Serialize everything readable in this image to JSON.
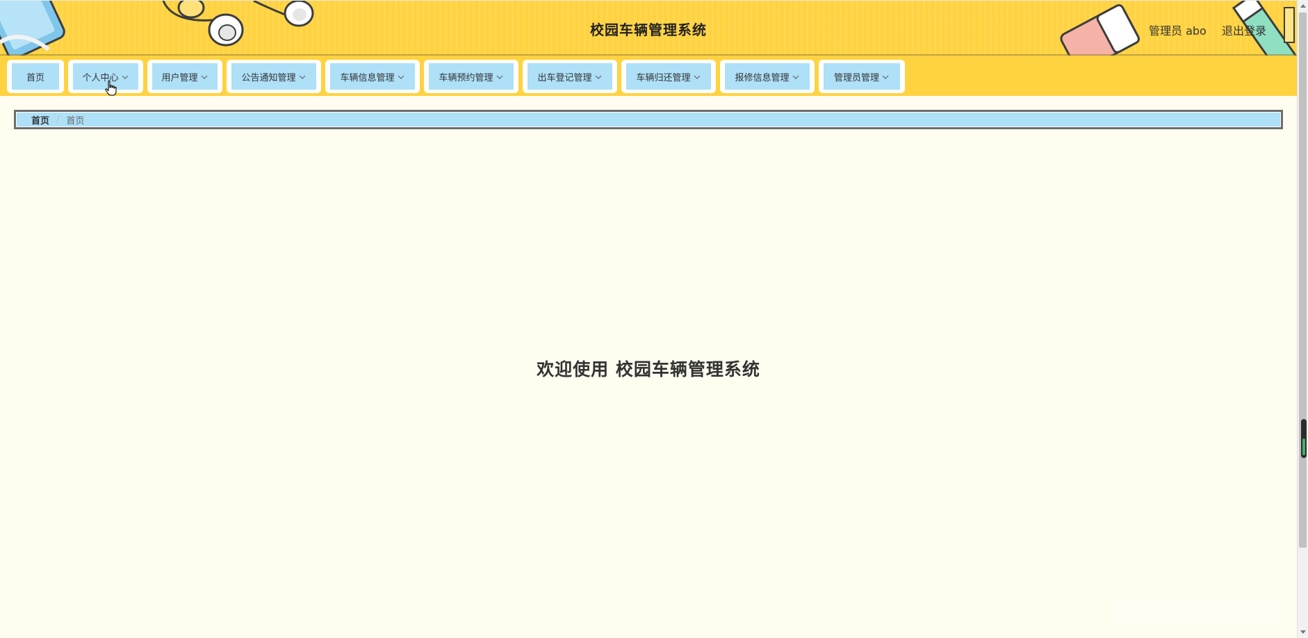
{
  "header": {
    "title": "校园车辆管理系统",
    "admin_label": "管理员 abo",
    "logout_label": "退出登录"
  },
  "nav": {
    "items": [
      {
        "label": "首页",
        "has_dropdown": false
      },
      {
        "label": "个人中心",
        "has_dropdown": true
      },
      {
        "label": "用户管理",
        "has_dropdown": true
      },
      {
        "label": "公告通知管理",
        "has_dropdown": true
      },
      {
        "label": "车辆信息管理",
        "has_dropdown": true
      },
      {
        "label": "车辆预约管理",
        "has_dropdown": true
      },
      {
        "label": "出车登记管理",
        "has_dropdown": true
      },
      {
        "label": "车辆归还管理",
        "has_dropdown": true
      },
      {
        "label": "报修信息管理",
        "has_dropdown": true
      },
      {
        "label": "管理员管理",
        "has_dropdown": true
      }
    ]
  },
  "breadcrumb": {
    "home": "首页",
    "separator": "/",
    "current": "首页"
  },
  "main": {
    "welcome": "欢迎使用 校园车辆管理系统"
  },
  "colors": {
    "header_bg": "#ffd23f",
    "nav_inner_bg": "#aee0f8",
    "page_bg": "#fffdf0"
  }
}
